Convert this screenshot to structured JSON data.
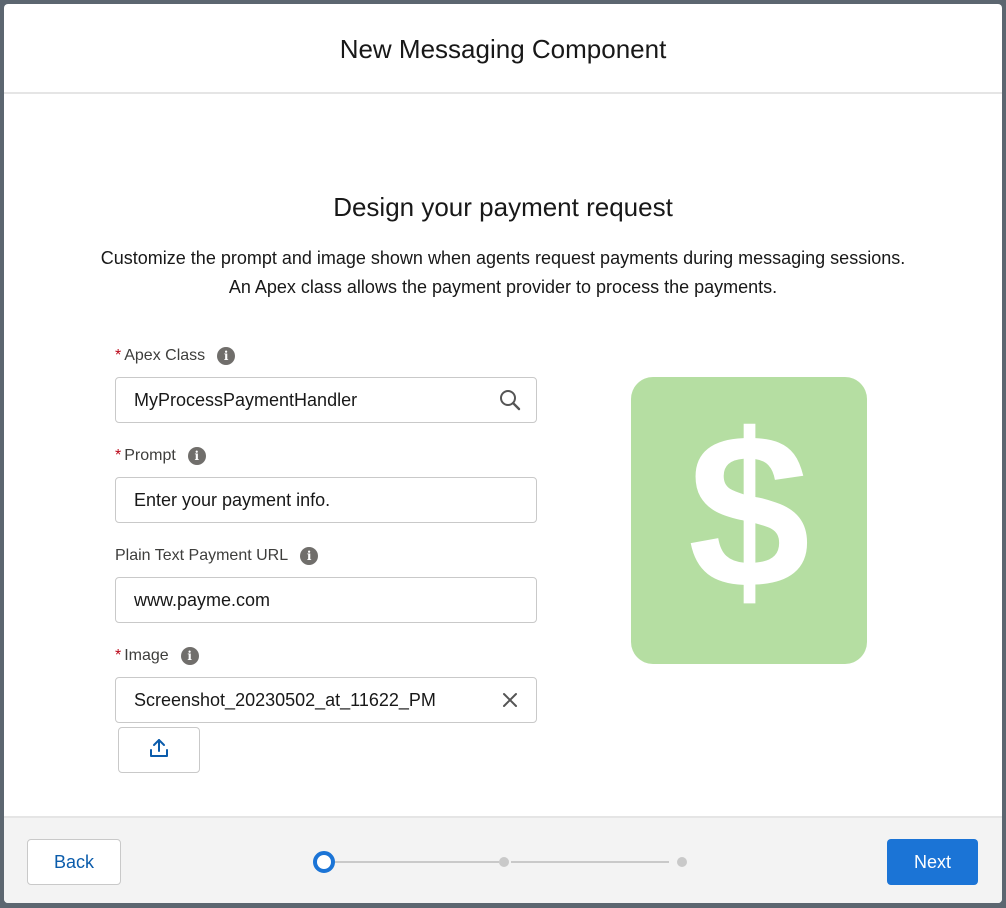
{
  "modal": {
    "title": "New Messaging Component"
  },
  "body": {
    "heading": "Design your payment request",
    "description": "Customize the prompt and image shown when agents request payments during messaging sessions. An Apex class allows the payment provider to process the payments."
  },
  "fields": {
    "apex_class": {
      "label": "Apex Class",
      "required": "*",
      "value": "MyProcessPaymentHandler",
      "icon": "search-icon"
    },
    "prompt": {
      "label": "Prompt",
      "required": "*",
      "value": "Enter your payment info."
    },
    "payment_url": {
      "label": "Plain Text Payment URL",
      "value": "www.payme.com"
    },
    "image": {
      "label": "Image",
      "required": "*",
      "value": "Screenshot_20230502_at_11622_PM",
      "icon": "clear-icon"
    },
    "info_icon_glyph": "i"
  },
  "upload": {
    "icon": "upload-icon"
  },
  "preview": {
    "icon": "dollar-icon",
    "glyph": "$",
    "color": "#b5dea2"
  },
  "footer": {
    "back_label": "Back",
    "next_label": "Next",
    "progress": {
      "current_step": 1,
      "total_steps": 3
    }
  },
  "colors": {
    "brand": "#1b74d6",
    "required": "#ba0517",
    "link": "#0b5cab"
  }
}
